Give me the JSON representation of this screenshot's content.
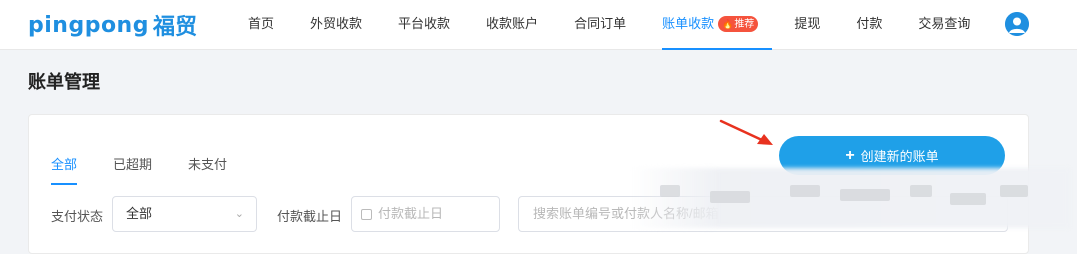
{
  "brand": {
    "name": "pingpong",
    "name_cn": "福贸",
    "color": "#1f8fe0"
  },
  "nav": {
    "items": [
      {
        "label": "首页"
      },
      {
        "label": "外贸收款"
      },
      {
        "label": "平台收款"
      },
      {
        "label": "收款账户"
      },
      {
        "label": "合同订单"
      },
      {
        "label": "账单收款",
        "active": true,
        "badge": "推荐"
      },
      {
        "label": "提现"
      },
      {
        "label": "付款"
      },
      {
        "label": "交易查询"
      }
    ],
    "accent": "#1890ff",
    "badge_color": "#f5533d"
  },
  "page": {
    "title": "账单管理"
  },
  "tabs": [
    {
      "label": "全部",
      "active": true
    },
    {
      "label": "已超期"
    },
    {
      "label": "未支付"
    }
  ],
  "actions": {
    "create_label": "创建新的账单",
    "create_color": "#1fa0e8"
  },
  "filters": {
    "status_label": "支付状态",
    "status_value": "全部",
    "due_label": "付款截止日",
    "due_placeholder": "付款截止日",
    "search_placeholder": "搜索账单编号或付款人名称/邮箱"
  },
  "icons": [
    "user-avatar-icon",
    "fire-icon",
    "plus-icon",
    "calendar-icon",
    "chevron-down-icon",
    "red-arrow-annotation"
  ]
}
